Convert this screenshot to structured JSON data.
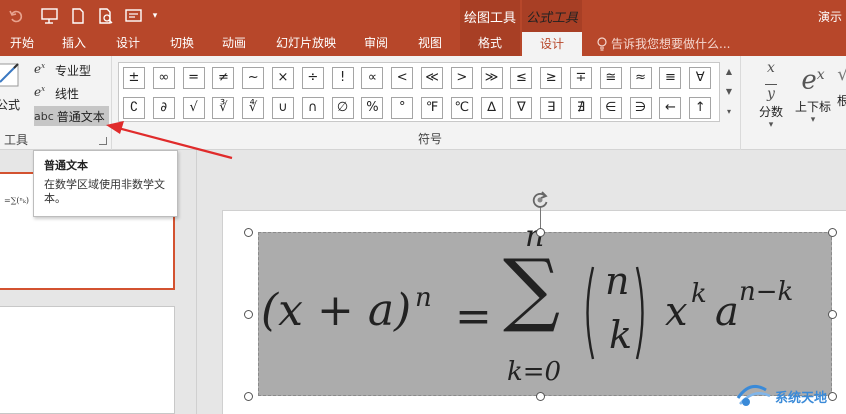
{
  "titlebar": {
    "app_title": "演示",
    "context_headers": [
      "绘图工具",
      "公式工具"
    ]
  },
  "tabs": [
    {
      "label": "开始"
    },
    {
      "label": "插入"
    },
    {
      "label": "设计"
    },
    {
      "label": "切换"
    },
    {
      "label": "动画"
    },
    {
      "label": "幻灯片放映"
    },
    {
      "label": "审阅"
    },
    {
      "label": "视图"
    },
    {
      "label": "格式"
    },
    {
      "label": "设计"
    }
  ],
  "tell_me": "告诉我您想要做什么...",
  "tools_group": {
    "insert_equation_label": "公式",
    "professional": "专业型",
    "linear": "线性",
    "normal_text_icon": "abc",
    "normal_text": "普通文本",
    "group_label": "工具"
  },
  "symbols": {
    "group_label": "符号",
    "row1": [
      "±",
      "∞",
      "=",
      "≠",
      "~",
      "×",
      "÷",
      "!",
      "∝",
      "<",
      "≪",
      ">",
      "≫",
      "≤",
      "≥",
      "∓",
      "≅",
      "≈",
      "≡",
      "∀"
    ],
    "row2": [
      "∁",
      "∂",
      "√",
      "∛",
      "∜",
      "∪",
      "∩",
      "∅",
      "%",
      "°",
      "℉",
      "℃",
      "∆",
      "∇",
      "∃",
      "∄",
      "∈",
      "∋",
      "←",
      "↑"
    ]
  },
  "structures": {
    "fraction_label": "分数",
    "script_label": "上下标",
    "radical_label_partial": "根"
  },
  "tooltip": {
    "title": "普通文本",
    "description": "在数学区域使用非数学文本。"
  },
  "equation": {
    "lhs": "(x + a)",
    "lhs_exp": "n",
    "equals": "=",
    "sum_top": "n",
    "sum_symbol": "∑",
    "sum_bottom": "k=0",
    "binom_top": "n",
    "binom_bottom": "k",
    "term_x": "x",
    "term_x_exp": "k",
    "term_a": "a",
    "term_a_exp": "n−k"
  },
  "watermark": "系统天地",
  "colors": {
    "accent": "#b7472a",
    "context_tab": "#a83f25",
    "selection_fill": "#acacac",
    "arrow": "#e02b2b"
  }
}
